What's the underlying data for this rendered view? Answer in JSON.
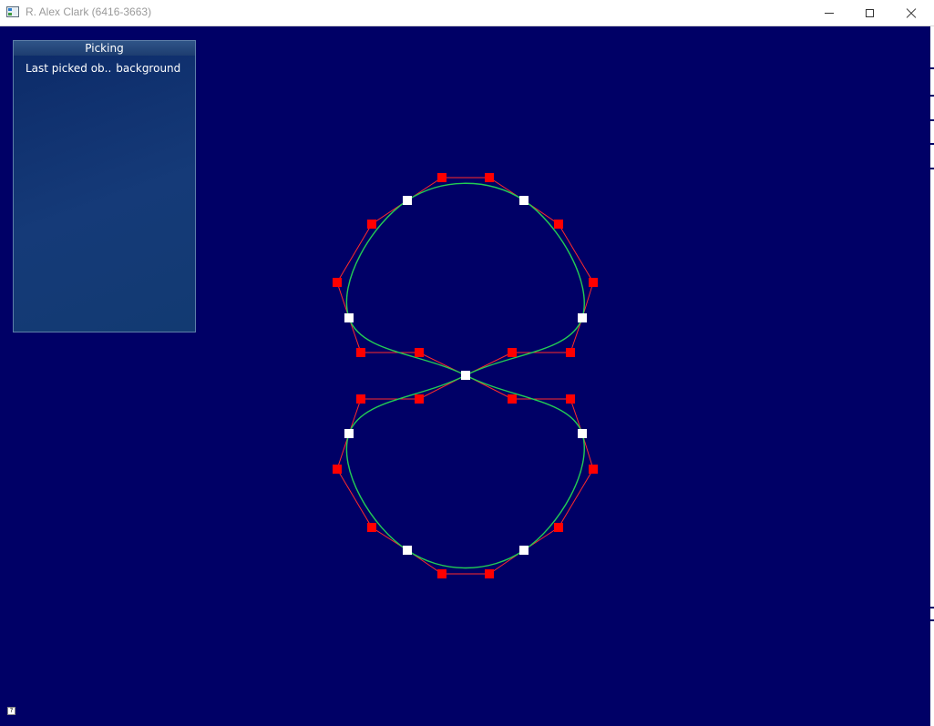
{
  "window": {
    "title": "R. Alex Clark (6416-3663)",
    "icon": "app-window-icon",
    "controls": [
      "minimize-icon",
      "maximize-icon",
      "close-icon"
    ]
  },
  "canvas": {
    "background_color": "#000066",
    "curve_color": "#22cc55",
    "polygon_color": "#ff2a2a",
    "control_point_color": "#ff0000",
    "interpolated_point_color": "#ffffff"
  },
  "picking_panel": {
    "title": "Picking",
    "label": "Last picked ob..",
    "value": "background"
  },
  "status": {
    "help_icon": "?"
  }
}
